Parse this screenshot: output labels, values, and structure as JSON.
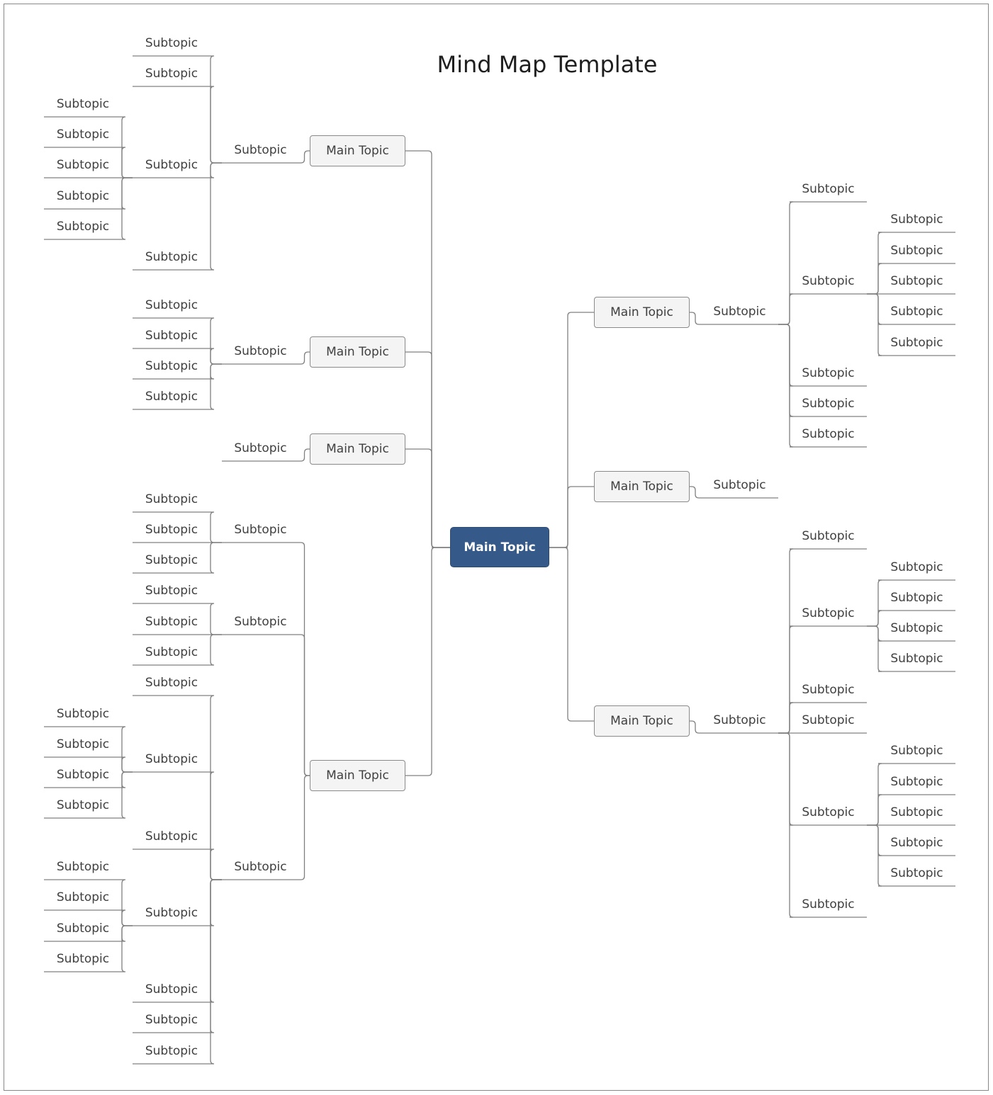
{
  "title": "Mind Map Template",
  "colors": {
    "central_fill": "#355a89",
    "topic_fill": "#f4f4f4",
    "line": "#808080"
  },
  "central": {
    "label": "Main Topic"
  },
  "nodes": {
    "L1": {
      "label": "Main Topic"
    },
    "L1a": {
      "label": "Subtopic"
    },
    "L1a1": {
      "label": "Subtopic"
    },
    "L1a2": {
      "label": "Subtopic"
    },
    "L1a3": {
      "label": "Subtopic"
    },
    "L1a4": {
      "label": "Subtopic"
    },
    "L1a3a": {
      "label": "Subtopic"
    },
    "L1a3b": {
      "label": "Subtopic"
    },
    "L1a3c": {
      "label": "Subtopic"
    },
    "L1a3d": {
      "label": "Subtopic"
    },
    "L1a3e": {
      "label": "Subtopic"
    },
    "L2": {
      "label": "Main Topic"
    },
    "L2a": {
      "label": "Subtopic"
    },
    "L2a1": {
      "label": "Subtopic"
    },
    "L2a2": {
      "label": "Subtopic"
    },
    "L2a3": {
      "label": "Subtopic"
    },
    "L2a4": {
      "label": "Subtopic"
    },
    "L3": {
      "label": "Main Topic"
    },
    "L3a": {
      "label": "Subtopic"
    },
    "L4": {
      "label": "Main Topic"
    },
    "L4a": {
      "label": "Subtopic"
    },
    "L4a1": {
      "label": "Subtopic"
    },
    "L4a2": {
      "label": "Subtopic"
    },
    "L4a3": {
      "label": "Subtopic"
    },
    "L4b": {
      "label": "Subtopic"
    },
    "L4b1": {
      "label": "Subtopic"
    },
    "L4b2": {
      "label": "Subtopic"
    },
    "L4b3": {
      "label": "Subtopic"
    },
    "L4c": {
      "label": "Subtopic"
    },
    "L4c1": {
      "label": "Subtopic"
    },
    "L4c2": {
      "label": "Subtopic"
    },
    "L4c2a": {
      "label": "Subtopic"
    },
    "L4c2b": {
      "label": "Subtopic"
    },
    "L4c2c": {
      "label": "Subtopic"
    },
    "L4c2d": {
      "label": "Subtopic"
    },
    "L4c3": {
      "label": "Subtopic"
    },
    "L4c4": {
      "label": "Subtopic"
    },
    "L4c4a": {
      "label": "Subtopic"
    },
    "L4c4b": {
      "label": "Subtopic"
    },
    "L4c4c": {
      "label": "Subtopic"
    },
    "L4c4d": {
      "label": "Subtopic"
    },
    "L4c5": {
      "label": "Subtopic"
    },
    "L4c6": {
      "label": "Subtopic"
    },
    "L4c7": {
      "label": "Subtopic"
    },
    "R1": {
      "label": "Main Topic"
    },
    "R1a": {
      "label": "Subtopic"
    },
    "R1a1": {
      "label": "Subtopic"
    },
    "R1a2": {
      "label": "Subtopic"
    },
    "R1a2a": {
      "label": "Subtopic"
    },
    "R1a2b": {
      "label": "Subtopic"
    },
    "R1a2c": {
      "label": "Subtopic"
    },
    "R1a2d": {
      "label": "Subtopic"
    },
    "R1a2e": {
      "label": "Subtopic"
    },
    "R1a3": {
      "label": "Subtopic"
    },
    "R1a4": {
      "label": "Subtopic"
    },
    "R1a5": {
      "label": "Subtopic"
    },
    "R2": {
      "label": "Main Topic"
    },
    "R2a": {
      "label": "Subtopic"
    },
    "R3": {
      "label": "Main Topic"
    },
    "R3a": {
      "label": "Subtopic"
    },
    "R3a1": {
      "label": "Subtopic"
    },
    "R3a2": {
      "label": "Subtopic"
    },
    "R3a2a": {
      "label": "Subtopic"
    },
    "R3a2b": {
      "label": "Subtopic"
    },
    "R3a2c": {
      "label": "Subtopic"
    },
    "R3a2d": {
      "label": "Subtopic"
    },
    "R3a3": {
      "label": "Subtopic"
    },
    "R3a4": {
      "label": "Subtopic"
    },
    "R3a5": {
      "label": "Subtopic"
    },
    "R3a5a": {
      "label": "Subtopic"
    },
    "R3a5b": {
      "label": "Subtopic"
    },
    "R3a5c": {
      "label": "Subtopic"
    },
    "R3a5d": {
      "label": "Subtopic"
    },
    "R3a5e": {
      "label": "Subtopic"
    },
    "R3a6": {
      "label": "Subtopic"
    }
  }
}
